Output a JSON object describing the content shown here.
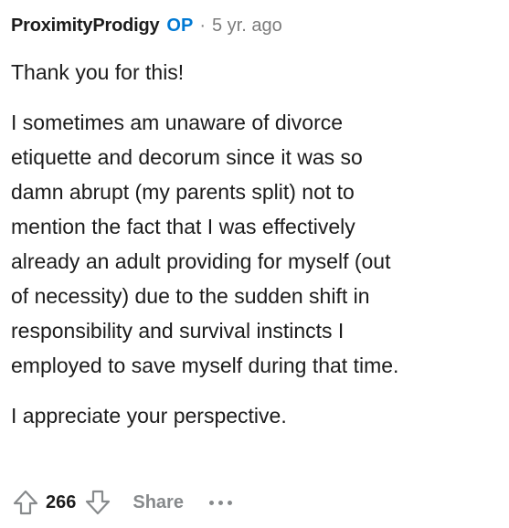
{
  "comment": {
    "author": "ProximityProdigy",
    "op_badge": "OP",
    "separator": "·",
    "age": "5 yr. ago",
    "paragraphs": [
      "Thank you for this!",
      "I sometimes am unaware of divorce\netiquette and decorum since it was so\ndamn abrupt (my parents split) not to\nmention the fact that I was effectively\nalready an adult providing for myself (out\nof necessity) due to the sudden shift in\nresponsibility and survival instincts I\nemployed to save myself during that time.",
      "I appreciate your perspective."
    ]
  },
  "actions": {
    "upvote_icon": "arrow-up-outline-icon",
    "score": "266",
    "downvote_icon": "arrow-down-outline-icon",
    "share_label": "Share",
    "more_icon": "ellipsis-icon"
  },
  "colors": {
    "text": "#1c1c1c",
    "op_blue": "#0079d3",
    "meta_gray": "#7c7c7c",
    "action_gray": "#878a8c"
  }
}
